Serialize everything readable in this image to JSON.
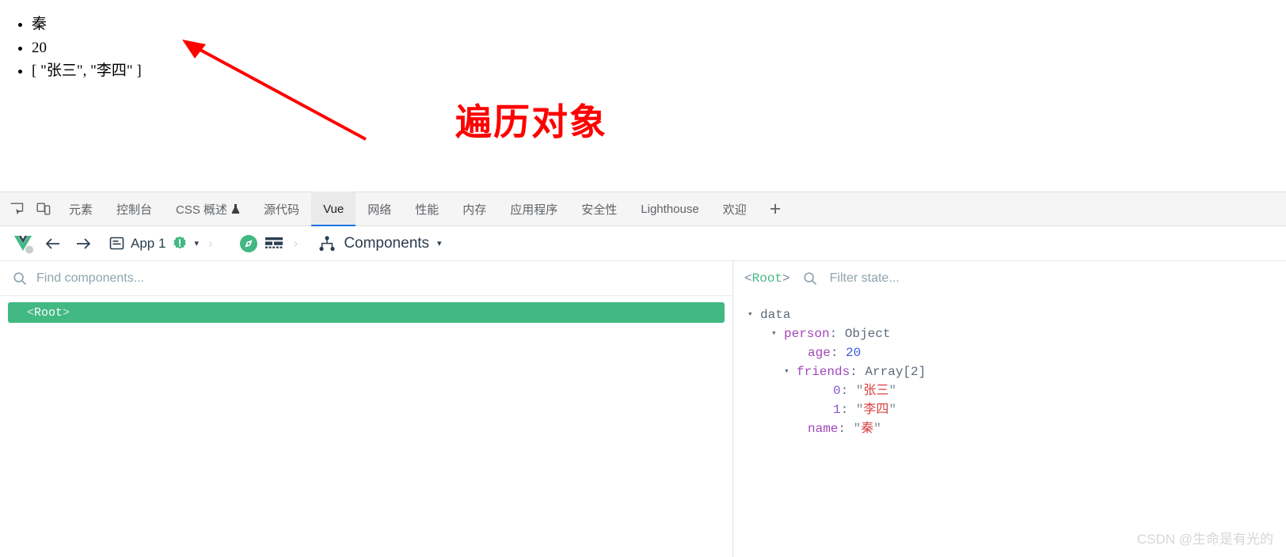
{
  "app_output": {
    "list_items": [
      "秦",
      "20",
      "[ \"张三\", \"李四\" ]"
    ]
  },
  "annotation": {
    "text": "遍历对象",
    "color": "#ff0000"
  },
  "devtools": {
    "icons": {
      "inspect": "inspect-element-icon",
      "device": "device-toolbar-icon"
    },
    "tabs": [
      {
        "label": "元素",
        "active": false
      },
      {
        "label": "控制台",
        "active": false
      },
      {
        "label": "CSS 概述",
        "active": false,
        "beaker": "⚗"
      },
      {
        "label": "源代码",
        "active": false
      },
      {
        "label": "Vue",
        "active": true
      },
      {
        "label": "网络",
        "active": false
      },
      {
        "label": "性能",
        "active": false
      },
      {
        "label": "内存",
        "active": false
      },
      {
        "label": "应用程序",
        "active": false
      },
      {
        "label": "安全性",
        "active": false
      },
      {
        "label": "Lighthouse",
        "active": false
      },
      {
        "label": "欢迎",
        "active": false
      }
    ],
    "add_tab_label": "+"
  },
  "vue_toolbar": {
    "logo": "vue-logo-icon",
    "back_label": "←",
    "forward_label": "→",
    "app_icon": "app-document-icon",
    "app_label": "App 1",
    "app_badge": "!",
    "app_badge_color": "#42b883",
    "caret": "▾",
    "separator": "›",
    "pane_compass_icon": "compass-icon",
    "pane_grid_icon": "grid-icon",
    "components_icon": "components-tree-icon",
    "components_label": "Components",
    "components_caret": "▾"
  },
  "components_pane": {
    "search_placeholder": "Find components...",
    "search_icon": "search-icon",
    "selected_component": {
      "open": "<",
      "name": "Root",
      "close": ">"
    }
  },
  "state_pane": {
    "root_tag": {
      "open": "<",
      "name": "Root",
      "close": ">"
    },
    "filter_placeholder": "Filter state...",
    "filter_icon": "search-icon",
    "tree": [
      {
        "indent": 0,
        "toggle": "▾",
        "key": "data",
        "key_style": "plain",
        "sep": "",
        "value": "",
        "value_style": ""
      },
      {
        "indent": 1,
        "toggle": "▾",
        "key": "person",
        "key_style": "key",
        "sep": ": ",
        "value": "Object",
        "value_style": "type"
      },
      {
        "indent": 2,
        "toggle": "",
        "key": "age",
        "key_style": "key",
        "sep": ": ",
        "value": "20",
        "value_style": "num"
      },
      {
        "indent": 2,
        "toggle": "▾",
        "key": "friends",
        "key_style": "key",
        "sep": ": ",
        "value": "Array[2]",
        "value_style": "type"
      },
      {
        "indent": 3,
        "toggle": "",
        "key": "0",
        "key_style": "idx",
        "sep": ": ",
        "value": "张三",
        "value_style": "str"
      },
      {
        "indent": 3,
        "toggle": "",
        "key": "1",
        "key_style": "idx",
        "sep": ": ",
        "value": "李四",
        "value_style": "str"
      },
      {
        "indent": 2,
        "toggle": "",
        "key": "name",
        "key_style": "key",
        "sep": ": ",
        "value": "秦",
        "value_style": "str"
      }
    ]
  },
  "watermark": {
    "text": "CSDN @生命是有光的"
  }
}
